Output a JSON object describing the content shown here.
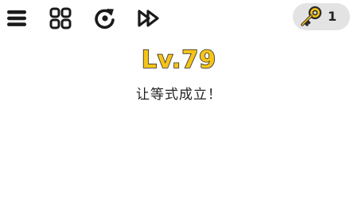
{
  "toolbar": {
    "menu_icon": "hamburger-icon",
    "levels_icon": "grid-icon",
    "restart_icon": "restart-icon",
    "skip_icon": "fast-forward-icon"
  },
  "keys": {
    "icon": "key-icon",
    "count": "1",
    "accent": "#f5c418"
  },
  "level": {
    "title": "Lv.79",
    "instruction": "让等式成立！"
  }
}
